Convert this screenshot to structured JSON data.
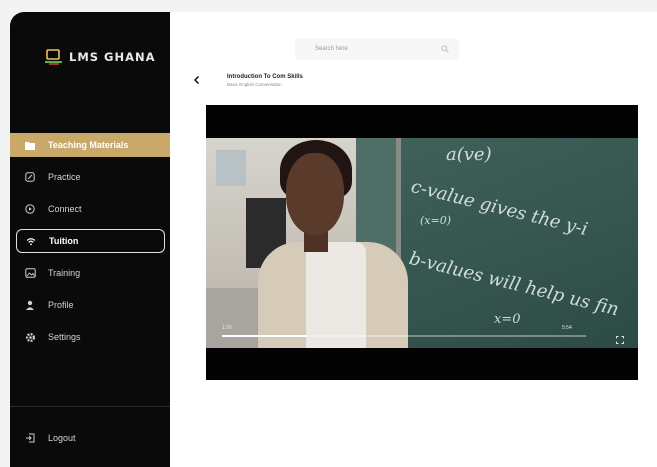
{
  "brand": {
    "name": "LMS GHANA",
    "accent": "#c8a96a"
  },
  "sidebar": {
    "items": [
      {
        "label": "Teaching Materials",
        "icon": "folder-icon",
        "state": "active"
      },
      {
        "label": "Practice",
        "icon": "edit-icon",
        "state": "default"
      },
      {
        "label": "Connect",
        "icon": "play-circle-icon",
        "state": "default"
      },
      {
        "label": "Tuition",
        "icon": "wifi-icon",
        "state": "outlined"
      },
      {
        "label": "Training",
        "icon": "image-icon",
        "state": "default"
      },
      {
        "label": "Profile",
        "icon": "user-icon",
        "state": "default"
      },
      {
        "label": "Settings",
        "icon": "gear-icon",
        "state": "default"
      }
    ],
    "logout_label": "Logout"
  },
  "search": {
    "placeholder": "Search here"
  },
  "lesson": {
    "title": "Introduction To Com Skills",
    "subtitle": "Basic English Conversation"
  },
  "video": {
    "board_text_1": "a(ve)",
    "board_text_2": "c-value gives the y-i",
    "board_text_3": "(x=0)",
    "board_text_4": "b-values will help us fin",
    "board_text_5": "x=0",
    "elapsed": "1:26",
    "duration": "5:54",
    "progress": 0.23
  }
}
